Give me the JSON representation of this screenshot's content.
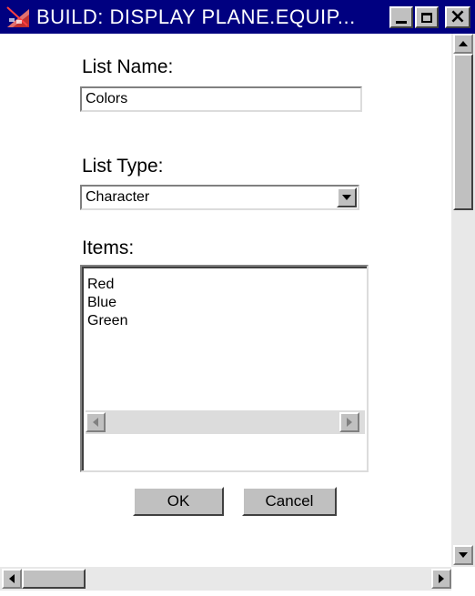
{
  "window": {
    "title": "BUILD: DISPLAY PLANE.EQUIP...",
    "icon": "build-app-icon",
    "title_color": "#000080"
  },
  "form": {
    "list_name_label": "List Name:",
    "list_name_value": "Colors",
    "list_type_label": "List Type:",
    "list_type_value": "Character",
    "items_label": "Items:",
    "items": [
      "Red",
      "Blue",
      "Green"
    ]
  },
  "buttons": {
    "ok_label": "OK",
    "cancel_label": "Cancel"
  }
}
